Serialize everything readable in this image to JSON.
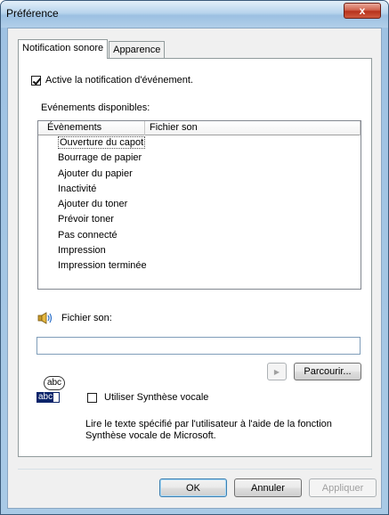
{
  "window": {
    "title": "Préférence",
    "close_glyph": "x"
  },
  "tabs": [
    {
      "label": "Notification sonore",
      "active": true
    },
    {
      "label": "Apparence",
      "active": false
    }
  ],
  "enable_notification": {
    "label": "Active la notification d'événement.",
    "checked": true
  },
  "events_group": {
    "label": "Evénements disponibles:"
  },
  "events_list": {
    "columns": [
      "Évènements",
      "Fichier son"
    ],
    "items": [
      "Ouverture du capot",
      "Bourrage de papier",
      "Ajouter du papier",
      "Inactivité",
      "Ajouter du toner",
      "Prévoir toner",
      "Pas connecté",
      "Impression",
      "Impression terminée"
    ]
  },
  "sound_file": {
    "label": "Fichier son:",
    "value": "",
    "icon": "speaker-icon"
  },
  "play_button": {
    "glyph": "▶"
  },
  "browse_button": {
    "label": "Parcourir..."
  },
  "tts": {
    "icon": "text-to-speech-icon",
    "icon_text_top": "abc",
    "icon_text_bottom": "abc",
    "checkbox_label": "Utiliser Synthèse vocale",
    "checked": false,
    "description_line1": "Lire le texte spécifié par l'utilisateur à l'aide de la fonction",
    "description_line2": "Synthèse vocale de Microsoft."
  },
  "footer": {
    "ok": "OK",
    "cancel": "Annuler",
    "apply": "Appliquer"
  }
}
